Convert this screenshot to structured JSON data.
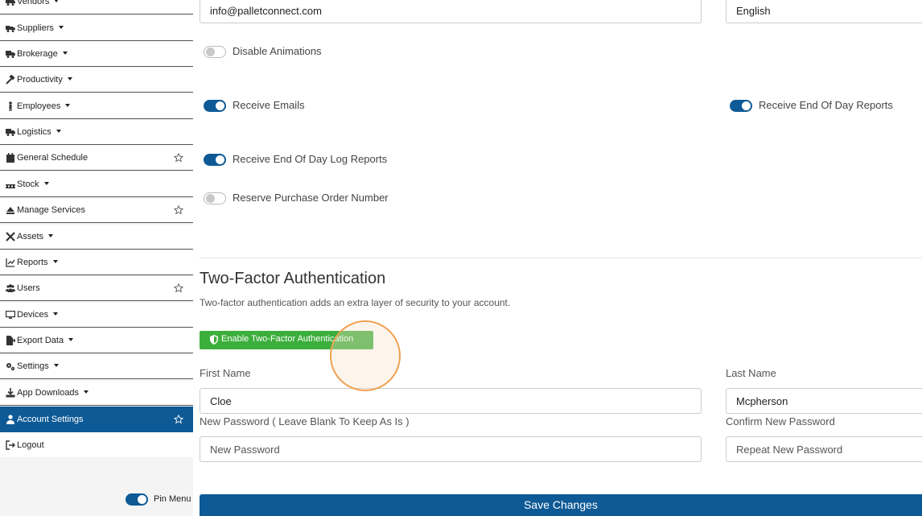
{
  "sidebar": {
    "items": [
      {
        "label": "Vendors",
        "icon": "truck-icon",
        "caret": true
      },
      {
        "label": "Suppliers",
        "icon": "truck-loading-icon",
        "caret": true
      },
      {
        "label": "Brokerage",
        "icon": "truck-icon",
        "caret": true
      },
      {
        "label": "Productivity",
        "icon": "hammer-icon",
        "caret": true
      },
      {
        "label": "Employees",
        "icon": "person-icon",
        "caret": true
      },
      {
        "label": "Logistics",
        "icon": "truck-icon",
        "caret": true
      },
      {
        "label": "General Schedule",
        "icon": "calendar-icon",
        "star": true
      },
      {
        "label": "Stock",
        "icon": "pallet-icon",
        "caret": true
      },
      {
        "label": "Manage Services",
        "icon": "eject-icon",
        "star": true
      },
      {
        "label": "Assets",
        "icon": "tools-icon",
        "caret": true
      },
      {
        "label": "Reports",
        "icon": "chart-line-icon",
        "caret": true
      },
      {
        "label": "Users",
        "icon": "users-icon",
        "star": true
      },
      {
        "label": "Devices",
        "icon": "desktop-icon",
        "caret": true
      },
      {
        "label": "Export Data",
        "icon": "file-export-icon",
        "caret": true
      },
      {
        "label": "Settings",
        "icon": "cogs-icon",
        "caret": true
      },
      {
        "label": "App Downloads",
        "icon": "download-icon",
        "caret": true
      },
      {
        "label": "Account Settings",
        "icon": "user-icon",
        "star": true,
        "active": true
      },
      {
        "label": "Logout",
        "icon": "sign-out-icon"
      }
    ],
    "pin_menu_label": "Pin Menu",
    "pin_menu_on": true
  },
  "form": {
    "email_value": "info@palletconnect.com",
    "language_value": "English",
    "toggles": {
      "disable_animations": {
        "label": "Disable Animations",
        "on": false
      },
      "receive_emails": {
        "label": "Receive Emails",
        "on": true
      },
      "receive_eod_reports": {
        "label": "Receive End Of Day Reports",
        "on": true
      },
      "receive_eod_log_reports": {
        "label": "Receive End Of Day Log Reports",
        "on": true
      },
      "reserve_po_number": {
        "label": "Reserve Purchase Order Number",
        "on": false
      }
    },
    "two_factor": {
      "title": "Two-Factor Authentication",
      "description": "Two-factor authentication adds an extra layer of security to your account.",
      "button_label": "Enable Two-Factor Authentication"
    },
    "first_name_label": "First Name",
    "first_name_value": "Cloe",
    "last_name_label": "Last Name",
    "last_name_value": "Mcpherson",
    "new_password_label": "New Password ( Leave Blank To Keep As Is )",
    "new_password_placeholder": "New Password",
    "confirm_password_label": "Confirm New Password",
    "confirm_password_placeholder": "Repeat New Password",
    "save_label": "Save Changes"
  },
  "colors": {
    "primary": "#0e5a96",
    "success": "#3cae3c",
    "cursor_highlight": "#f0a050"
  }
}
